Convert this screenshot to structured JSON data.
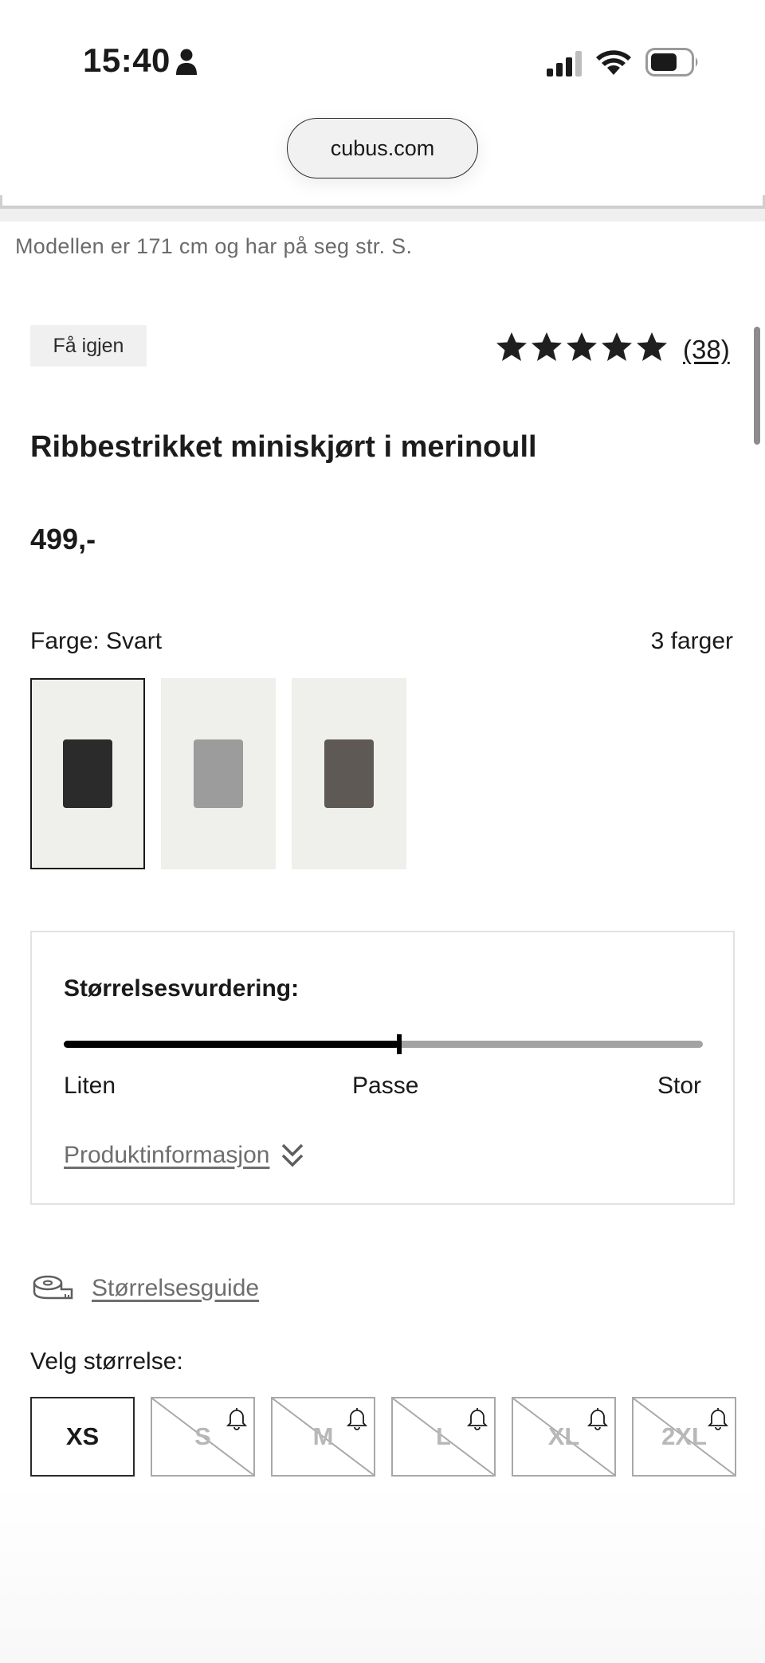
{
  "status_bar": {
    "time": "15:40"
  },
  "browser": {
    "url": "cubus.com"
  },
  "product": {
    "model_note": "Modellen er 171 cm og har på seg str. S.",
    "badge": "Få igjen",
    "rating": {
      "stars": 5,
      "count": "(38)"
    },
    "title": "Ribbestrikket miniskjørt i merinoull",
    "price": "499,-",
    "color_label": "Farge: Svart",
    "color_count": "3 farger",
    "swatches": [
      {
        "color": "#2b2b2b",
        "selected": true
      },
      {
        "color": "#9c9c9c",
        "selected": false
      },
      {
        "color": "#5e5954",
        "selected": false
      }
    ]
  },
  "fit": {
    "title": "Størrelsesvurdering:",
    "value_fraction": 0.525,
    "left_label": "Liten",
    "mid_label": "Passe",
    "right_label": "Stor",
    "product_info_link": "Produktinformasjon"
  },
  "size_guide": {
    "link": "Størrelsesguide"
  },
  "sizes": {
    "label": "Velg størrelse:",
    "options": [
      {
        "label": "XS",
        "available": true
      },
      {
        "label": "S",
        "available": false
      },
      {
        "label": "M",
        "available": false
      },
      {
        "label": "L",
        "available": false
      },
      {
        "label": "XL",
        "available": false
      },
      {
        "label": "2XL",
        "available": false
      }
    ]
  },
  "colors": {
    "text": "#1a1a1a",
    "muted": "#6e6e6e",
    "badge_bg": "#f0f0f0",
    "swatch_bg": "#efefeb"
  }
}
